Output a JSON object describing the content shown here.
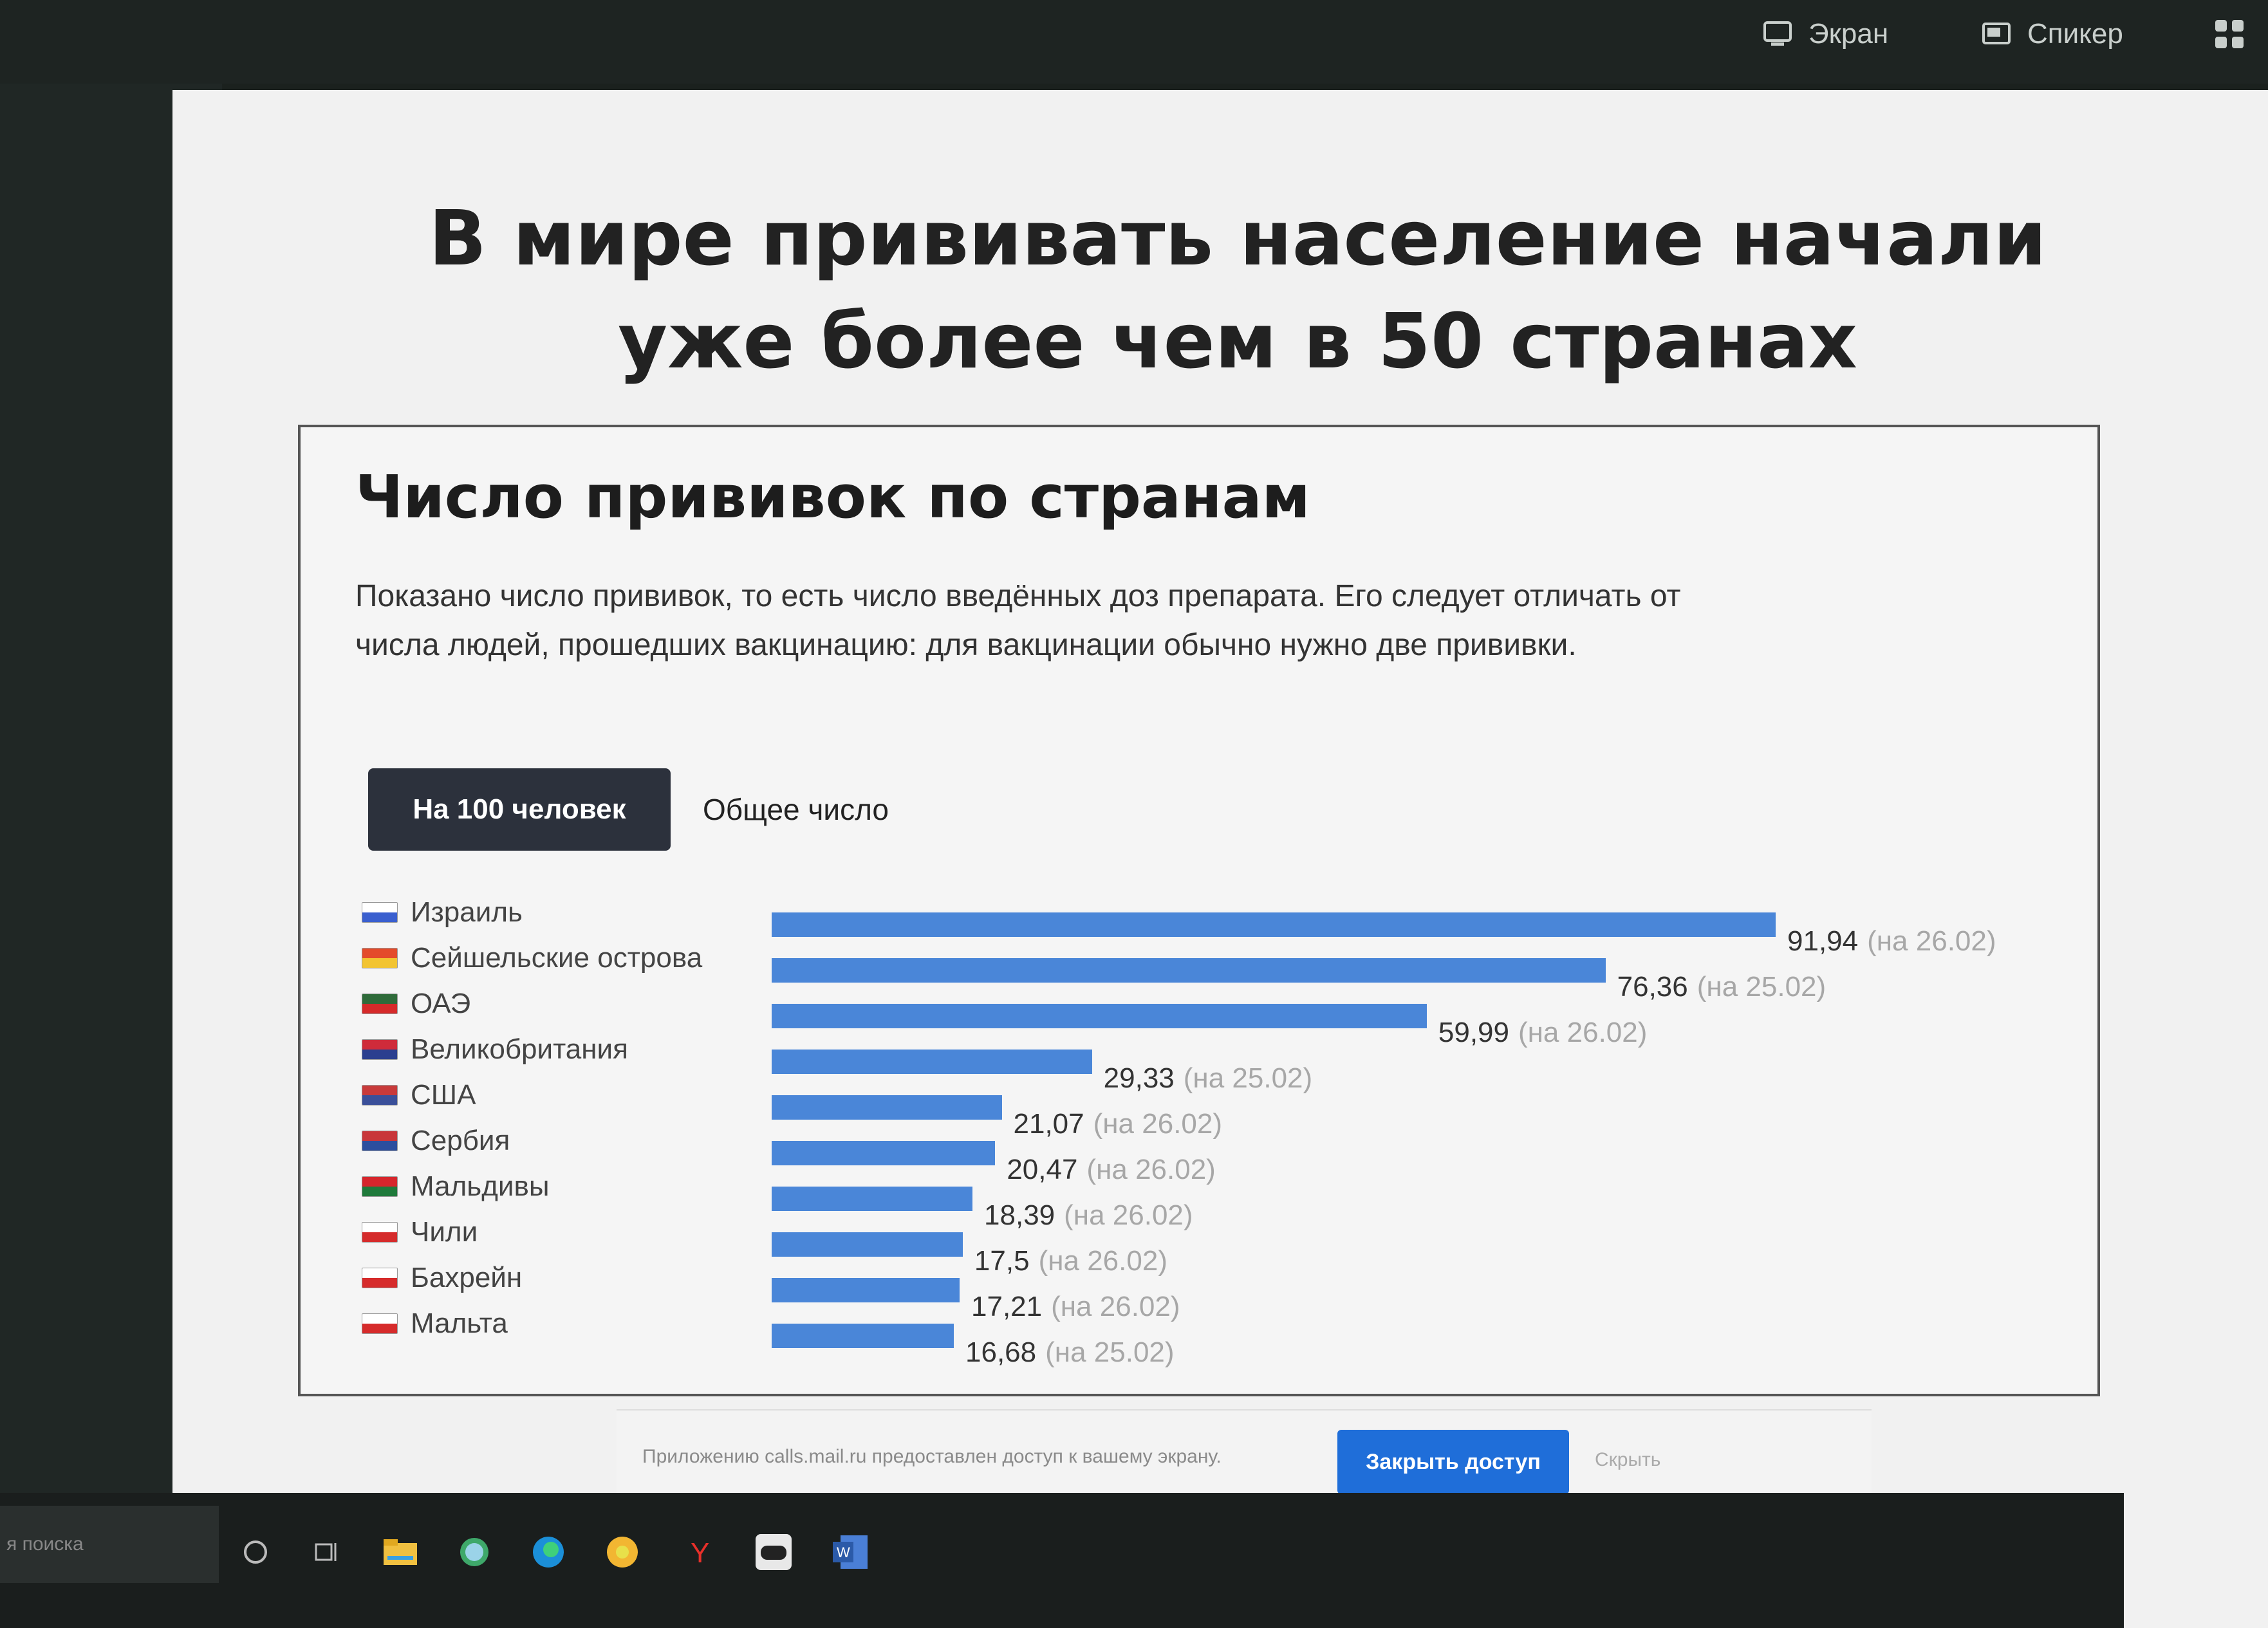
{
  "topbar": {
    "screen_label": "Экран",
    "speaker_label": "Спикер"
  },
  "slide": {
    "title": "В мире прививать население начали уже более чем в 50 странах"
  },
  "chart": {
    "title": "Число прививок по странам",
    "description": "Показано число прививок, то есть число введённых доз препарата. Его следует отличать от числа людей, прошедших вакцинацию: для вакцинации обычно нужно две прививки.",
    "toggle_active": "На 100 человек",
    "toggle_inactive": "Общее число"
  },
  "chart_data": {
    "type": "bar",
    "categories": [
      "Израиль",
      "Сейшельские острова",
      "ОАЭ",
      "Великобритания",
      "США",
      "Сербия",
      "Мальдивы",
      "Чили",
      "Бахрейн",
      "Мальта"
    ],
    "values": [
      91.94,
      76.36,
      59.99,
      29.33,
      21.07,
      20.47,
      18.39,
      17.5,
      17.21,
      16.68
    ],
    "value_labels": [
      "91,94",
      "76,36",
      "59,99",
      "29,33",
      "21,07",
      "20,47",
      "18,39",
      "17,5",
      "17,21",
      "16,68"
    ],
    "dates": [
      "(на 26.02)",
      "(на 25.02)",
      "(на 26.02)",
      "(на 25.02)",
      "(на 26.02)",
      "(на 26.02)",
      "(на 26.02)",
      "(на 26.02)",
      "(на 26.02)",
      "(на 25.02)"
    ],
    "title": "Число прививок по странам",
    "bar_color": "#4a86d8",
    "xlim": [
      0,
      91.94
    ]
  },
  "flags": [
    {
      "c1": "#ffffff",
      "c2": "#3a5fcf"
    },
    {
      "c1": "#e44b2b",
      "c2": "#f2c431"
    },
    {
      "c1": "#2f6b3a",
      "c2": "#d62a2a"
    },
    {
      "c1": "#cf2b3a",
      "c2": "#2b3f8f"
    },
    {
      "c1": "#c83a3a",
      "c2": "#3a4f99"
    },
    {
      "c1": "#c8363a",
      "c2": "#2c4e9e"
    },
    {
      "c1": "#d6262c",
      "c2": "#1f7a3b"
    },
    {
      "c1": "#ffffff",
      "c2": "#d52b2b"
    },
    {
      "c1": "#ffffff",
      "c2": "#d62b2b"
    },
    {
      "c1": "#ffffff",
      "c2": "#d62b2b"
    }
  ],
  "share": {
    "text": "Приложению calls.mail.ru предоставлен доступ к вашему экрану.",
    "close_button": "Закрыть доступ",
    "hide_label": "Скрыть"
  },
  "taskbar": {
    "search_placeholder": "я поиска"
  }
}
